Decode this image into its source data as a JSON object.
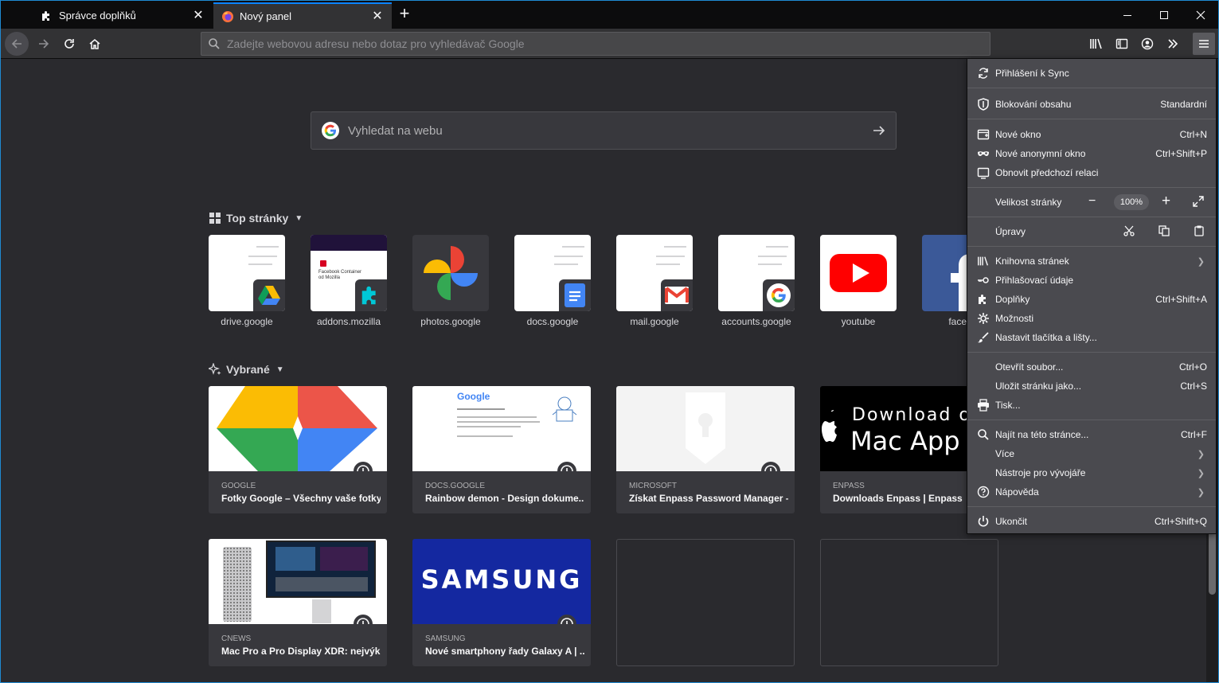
{
  "tabs": [
    {
      "title": "Správce doplňků"
    },
    {
      "title": "Nový panel"
    }
  ],
  "urlbar": {
    "placeholder": "Zadejte webovou adresu nebo dotaz pro vyhledávač Google"
  },
  "search": {
    "placeholder": "Vyhledat na webu"
  },
  "sections": {
    "top_sites": "Top stránky",
    "highlights": "Vybrané"
  },
  "top_sites": [
    {
      "label": "drive.google"
    },
    {
      "label": "addons.mozilla"
    },
    {
      "label": "photos.google"
    },
    {
      "label": "docs.google"
    },
    {
      "label": "mail.google"
    },
    {
      "label": "accounts.google"
    },
    {
      "label": "youtube"
    },
    {
      "label": "faceb"
    }
  ],
  "addons_preview": {
    "title": "Facebook Container od Mozilla"
  },
  "highlights": [
    {
      "source": "GOOGLE",
      "title": "Fotky Google – Všechny vaše fotky..."
    },
    {
      "source": "DOCS.GOOGLE",
      "title": "Rainbow demon - Design dokume..."
    },
    {
      "source": "MICROSOFT",
      "title": "Získat Enpass Password Manager –..."
    },
    {
      "source": "ENPASS",
      "title": "Downloads Enpass | Enpass"
    },
    {
      "source": "CNEWS",
      "title": "Mac Pro a Pro Display XDR: nejvýk..."
    },
    {
      "source": "SAMSUNG",
      "title": "Nové smartphony řady Galaxy A | ..."
    }
  ],
  "thumb_text": {
    "google_logo": "Google",
    "samsung": "SAMSUNG",
    "apple_line1": "Download on",
    "apple_line2": "Mac App S"
  },
  "menu": {
    "sync": "Přihlášení k Sync",
    "blocking": "Blokování obsahu",
    "blocking_value": "Standardní",
    "new_window": "Nové okno",
    "new_window_sc": "Ctrl+N",
    "private": "Nové anonymní okno",
    "private_sc": "Ctrl+Shift+P",
    "restore": "Obnovit předchozí relaci",
    "zoom": "Velikost stránky",
    "zoom_value": "100%",
    "edit": "Úpravy",
    "library": "Knihovna stránek",
    "logins": "Přihlašovací údaje",
    "addons": "Doplňky",
    "addons_sc": "Ctrl+Shift+A",
    "options": "Možnosti",
    "customize": "Nastavit tlačítka a lišty...",
    "open_file": "Otevřít soubor...",
    "open_file_sc": "Ctrl+O",
    "save_page": "Uložit stránku jako...",
    "save_page_sc": "Ctrl+S",
    "print": "Tisk...",
    "find": "Najít na této stránce...",
    "find_sc": "Ctrl+F",
    "more": "Více",
    "devtools": "Nástroje pro vývojáře",
    "help": "Nápověda",
    "quit": "Ukončit",
    "quit_sc": "Ctrl+Shift+Q"
  },
  "colors": {
    "accent": "#0a84ff",
    "menu_bg": "#4a4a4f",
    "page_bg": "#2a2a2e"
  }
}
